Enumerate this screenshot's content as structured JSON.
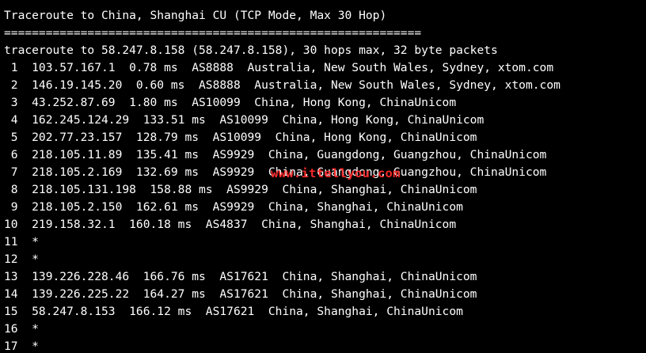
{
  "terminal": {
    "background": "#000000",
    "text_color": "#ffffff",
    "lines": [
      "Traceroute to China, Shanghai CU (TCP Mode, Max 30 Hop)",
      "============================================================",
      "traceroute to 58.247.8.158 (58.247.8.158), 30 hops max, 32 byte packets",
      " 1  103.57.167.1  0.78 ms  AS8888  Australia, New South Wales, Sydney, xtom.com",
      " 2  146.19.145.20  0.60 ms  AS8888  Australia, New South Wales, Sydney, xtom.com",
      " 3  43.252.87.69  1.80 ms  AS10099  China, Hong Kong, ChinaUnicom",
      " 4  162.245.124.29  133.51 ms  AS10099  China, Hong Kong, ChinaUnicom",
      " 5  202.77.23.157  128.79 ms  AS10099  China, Hong Kong, ChinaUnicom",
      " 6  218.105.11.89  135.41 ms  AS9929  China, Guangdong, Guangzhou, ChinaUnicom",
      " 7  218.105.2.169  132.69 ms  AS9929  China, Guangdong, Guangzhou, ChinaUnicom",
      " 8  218.105.131.198  158.88 ms  AS9929  China, Shanghai, ChinaUnicom",
      " 9  218.105.2.150  162.61 ms  AS9929  China, Shanghai, ChinaUnicom",
      "10  219.158.32.1  160.18 ms  AS4837  China, Shanghai, ChinaUnicom",
      "11  *",
      "12  *",
      "13  139.226.228.46  166.76 ms  AS17621  China, Shanghai, ChinaUnicom",
      "14  139.226.225.22  164.27 ms  AS17621  China, Shanghai, ChinaUnicom",
      "15  58.247.8.153  166.12 ms  AS17621  China, Shanghai, ChinaUnicom",
      "16  *",
      "17  *"
    ]
  },
  "watermark": {
    "text": "www.ittellyou.com",
    "color": "#ff2a2a"
  }
}
